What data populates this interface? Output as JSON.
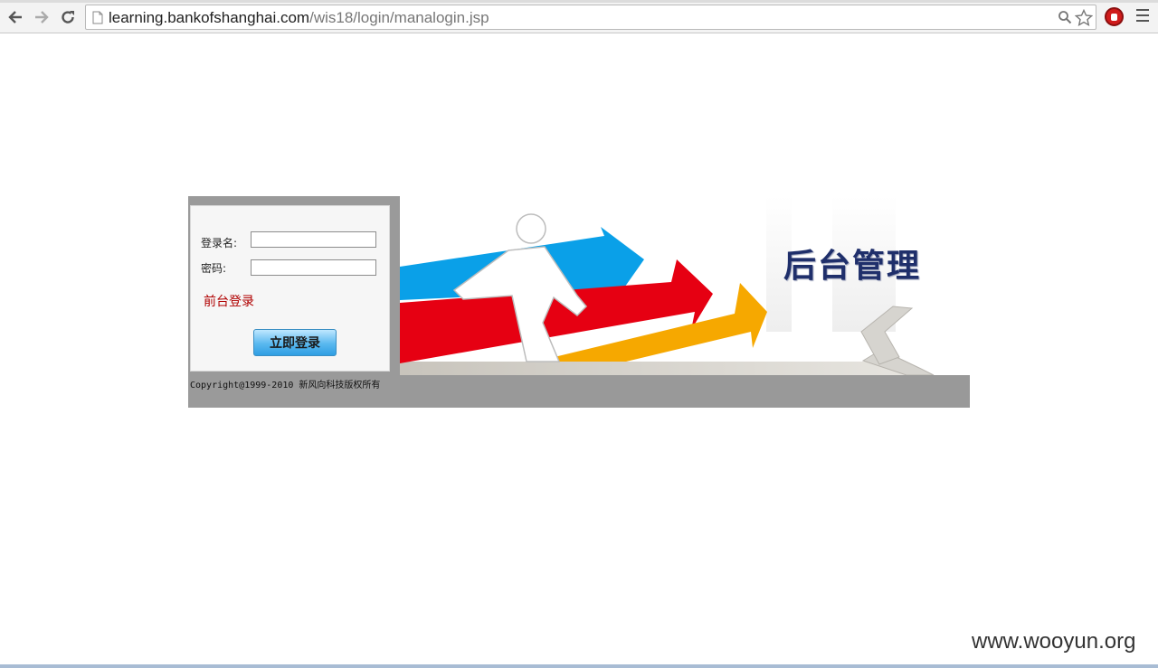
{
  "browser": {
    "url_host": "learning.bankofshanghai.com",
    "url_path": "/wis18/login/manalogin.jsp"
  },
  "login": {
    "username_label": "登录名:",
    "password_label": "密码:",
    "username_value": "",
    "password_value": "",
    "front_link": "前台登录",
    "submit_label": "立即登录"
  },
  "banner": {
    "title": "后台管理"
  },
  "footer": {
    "copyright": "Copyright@1999-2010 新风向科技版权所有"
  },
  "watermark": "www.wooyun.org",
  "colors": {
    "accent_blue": "#0aa0e8",
    "accent_red": "#e60012",
    "accent_orange": "#f6a800",
    "title": "#1f2f6b",
    "link": "#b00000"
  }
}
